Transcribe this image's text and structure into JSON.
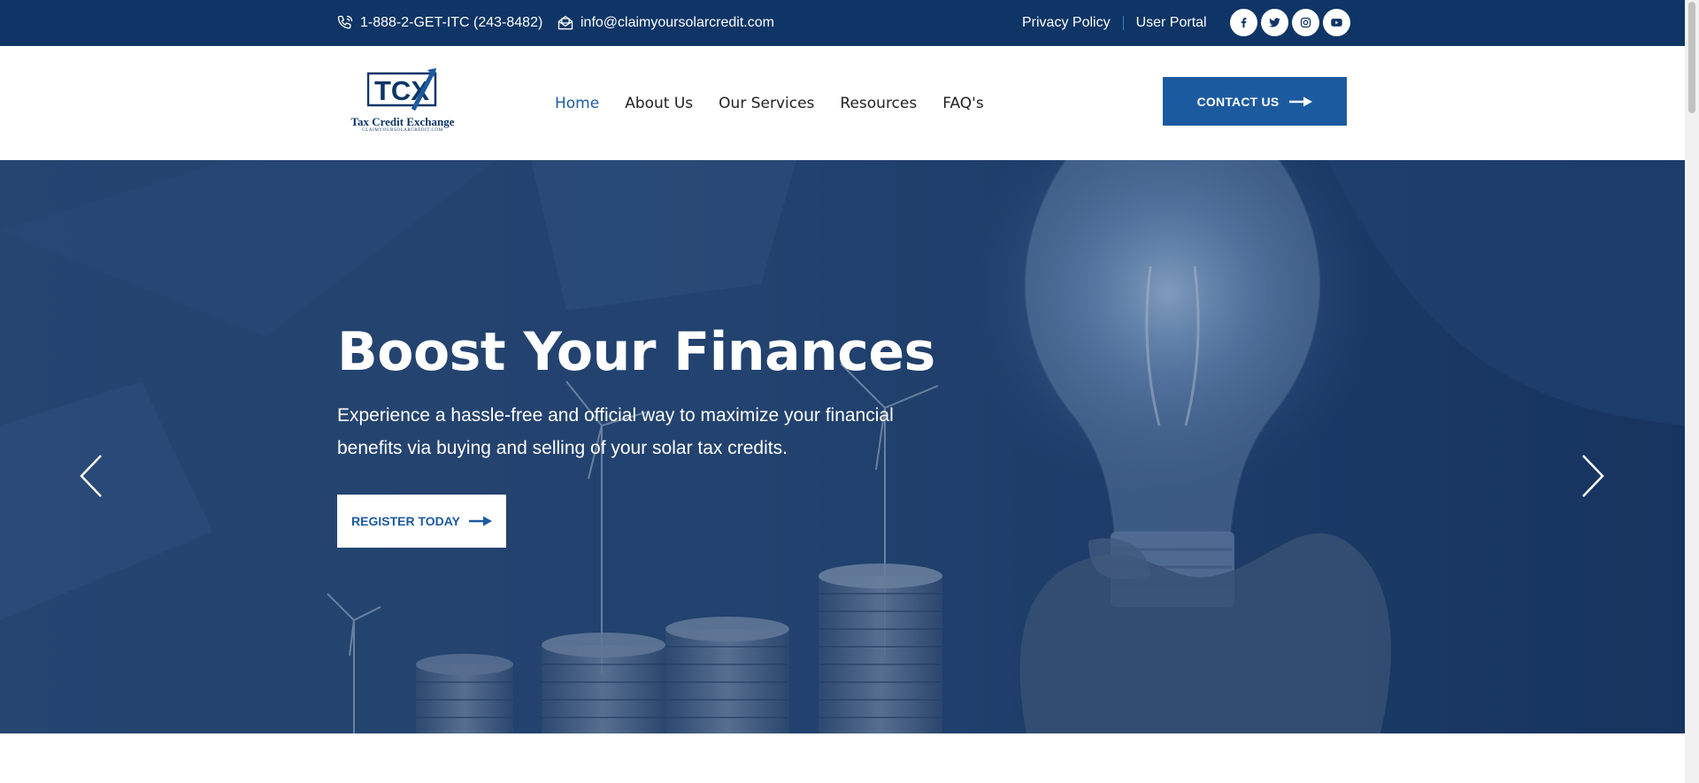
{
  "topbar": {
    "phone": "1-888-2-GET-ITC (243-8482)",
    "email": "info@claimyoursolarcredit.com",
    "privacy_policy": "Privacy Policy",
    "user_portal": "User Portal",
    "socials": [
      "facebook-icon",
      "twitter-icon",
      "instagram-icon",
      "youtube-icon"
    ]
  },
  "logo": {
    "mark": "TCX",
    "name": "Tax Credit Exchange",
    "url": "CLAIMYOURSOLARCREDIT.COM"
  },
  "nav": {
    "items": [
      "Home",
      "About Us",
      "Our Services",
      "Resources",
      "FAQ's"
    ],
    "active": "Home"
  },
  "header": {
    "contact_label": "CONTACT US"
  },
  "hero": {
    "title": "Boost Your Finances",
    "subtitle": "Experience a hassle-free and official way to maximize your financial benefits via buying and selling of your solar tax credits.",
    "cta_label": "REGISTER TODAY"
  },
  "colors": {
    "topbar": "#0e3566",
    "accent": "#1c5aa0",
    "nav_active": "#1a5ba8",
    "text": "#222222"
  }
}
